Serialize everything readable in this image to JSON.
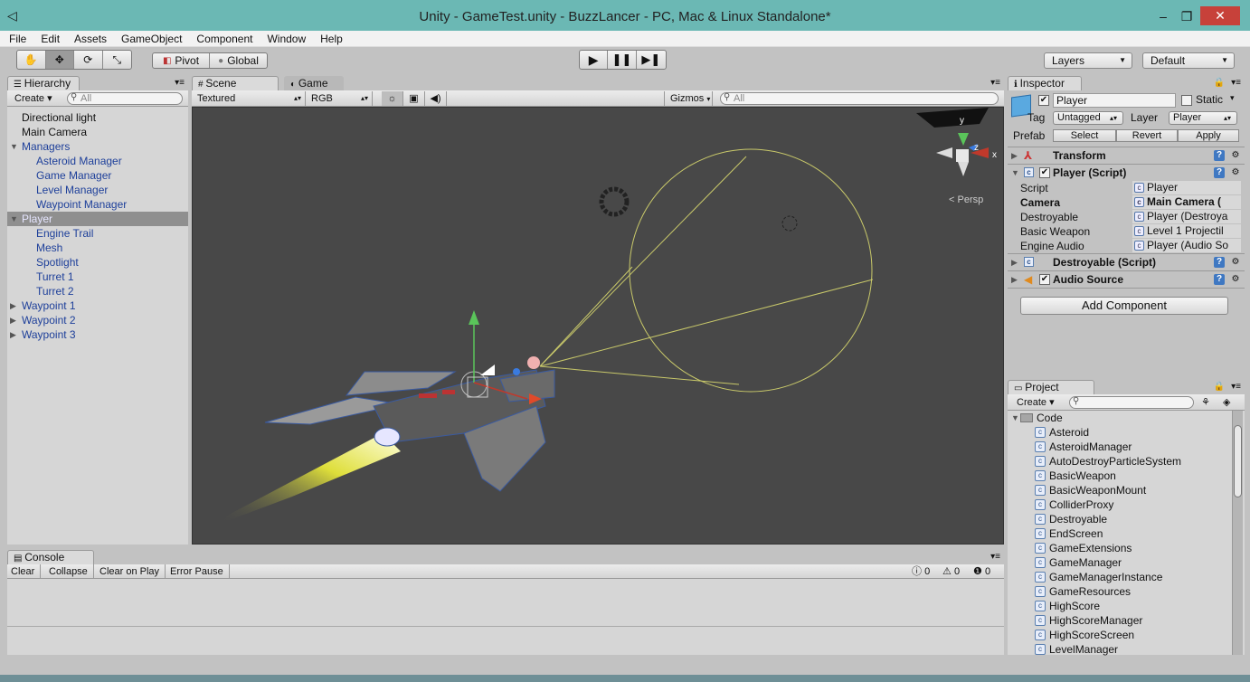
{
  "window": {
    "title": "Unity - GameTest.unity - BuzzLancer - PC, Mac & Linux Standalone*",
    "minimize": "‒",
    "maximize": "❐",
    "close": "✕"
  },
  "menu": [
    "File",
    "Edit",
    "Assets",
    "GameObject",
    "Component",
    "Window",
    "Help"
  ],
  "toolbar": {
    "pivot": "Pivot",
    "global": "Global",
    "layers": "Layers",
    "layout": "Default"
  },
  "hierarchy": {
    "tab": "Hierarchy",
    "create": "Create",
    "search_placeholder": "All",
    "items": [
      {
        "label": "Directional light",
        "indent": 0,
        "arrow": "",
        "color": "black"
      },
      {
        "label": "Main Camera",
        "indent": 0,
        "arrow": "",
        "color": "black"
      },
      {
        "label": "Managers",
        "indent": 0,
        "arrow": "▼",
        "color": "blue"
      },
      {
        "label": "Asteroid Manager",
        "indent": 1,
        "arrow": "",
        "color": "blue"
      },
      {
        "label": "Game Manager",
        "indent": 1,
        "arrow": "",
        "color": "blue"
      },
      {
        "label": "Level Manager",
        "indent": 1,
        "arrow": "",
        "color": "blue"
      },
      {
        "label": "Waypoint Manager",
        "indent": 1,
        "arrow": "",
        "color": "blue"
      },
      {
        "label": "Player",
        "indent": 0,
        "arrow": "▼",
        "color": "selected"
      },
      {
        "label": "Engine Trail",
        "indent": 1,
        "arrow": "",
        "color": "blue"
      },
      {
        "label": "Mesh",
        "indent": 1,
        "arrow": "",
        "color": "blue"
      },
      {
        "label": "Spotlight",
        "indent": 1,
        "arrow": "",
        "color": "blue"
      },
      {
        "label": "Turret 1",
        "indent": 1,
        "arrow": "",
        "color": "blue"
      },
      {
        "label": "Turret 2",
        "indent": 1,
        "arrow": "",
        "color": "blue"
      },
      {
        "label": "Waypoint 1",
        "indent": 0,
        "arrow": "▶",
        "color": "blue"
      },
      {
        "label": "Waypoint 2",
        "indent": 0,
        "arrow": "▶",
        "color": "blue"
      },
      {
        "label": "Waypoint 3",
        "indent": 0,
        "arrow": "▶",
        "color": "blue"
      }
    ]
  },
  "scene": {
    "tab_scene": "Scene",
    "tab_game": "Game",
    "draw_mode": "Textured",
    "render_mode": "RGB",
    "gizmos": "Gizmos",
    "search_placeholder": "All",
    "persp": "Persp",
    "axis_y": "y",
    "axis_z": "z",
    "axis_x": "x"
  },
  "inspector": {
    "tab": "Inspector",
    "object_name": "Player",
    "static_label": "Static",
    "tag_label": "Tag",
    "tag_value": "Untagged",
    "layer_label": "Layer",
    "layer_value": "Player",
    "prefab_label": "Prefab",
    "prefab_select": "Select",
    "prefab_revert": "Revert",
    "prefab_apply": "Apply",
    "components": {
      "transform": "Transform",
      "player_script": "Player (Script)",
      "destroyable": "Destroyable (Script)",
      "audio_source": "Audio Source"
    },
    "fields": [
      {
        "label": "Script",
        "value": "Player",
        "bold": false
      },
      {
        "label": "Camera",
        "value": "Main Camera (",
        "bold": true
      },
      {
        "label": "Destroyable",
        "value": "Player (Destroya",
        "bold": false
      },
      {
        "label": "Basic Weapon",
        "value": "Level 1 Projectil",
        "bold": false
      },
      {
        "label": "Engine Audio",
        "value": "Player (Audio So",
        "bold": false
      }
    ],
    "add_component": "Add Component"
  },
  "project": {
    "tab": "Project",
    "create": "Create",
    "folder": "Code",
    "scripts": [
      "Asteroid",
      "AsteroidManager",
      "AutoDestroyParticleSystem",
      "BasicWeapon",
      "BasicWeaponMount",
      "ColliderProxy",
      "Destroyable",
      "EndScreen",
      "GameExtensions",
      "GameManager",
      "GameManagerInstance",
      "GameResources",
      "HighScore",
      "HighScoreManager",
      "HighScoreScreen",
      "LevelManager"
    ]
  },
  "console": {
    "tab": "Console",
    "clear": "Clear",
    "collapse": "Collapse",
    "clear_on_play": "Clear on Play",
    "error_pause": "Error Pause",
    "info_count": "0",
    "warn_count": "0",
    "error_count": "0"
  }
}
